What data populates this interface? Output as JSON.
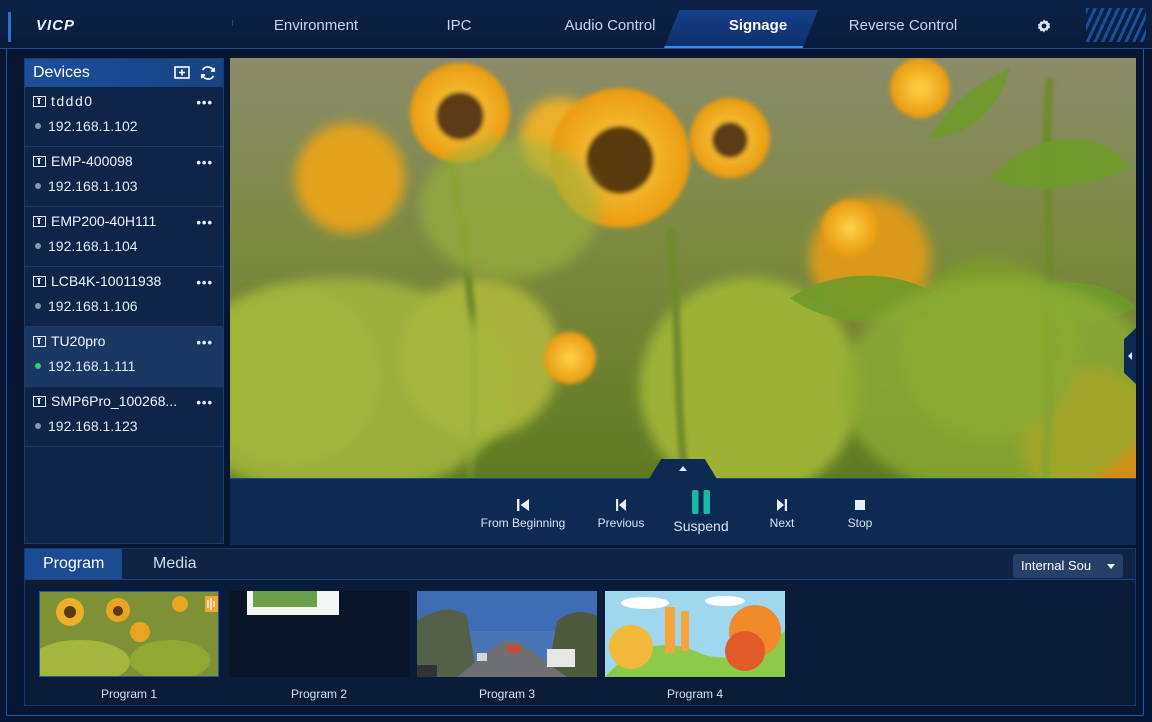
{
  "app": {
    "logo": "VICP"
  },
  "nav": {
    "items": [
      {
        "label": "Environment"
      },
      {
        "label": "IPC"
      },
      {
        "label": "Audio Control"
      },
      {
        "label": "Signage"
      },
      {
        "label": "Reverse Control"
      }
    ],
    "active": "Signage",
    "settings_icon": "gear-icon"
  },
  "devices": {
    "title": "Devices",
    "icons": [
      "add-screen-icon",
      "refresh-icon"
    ],
    "items": [
      {
        "name": "tddd0",
        "ip": "192.168.1.102",
        "online": false
      },
      {
        "name": "EMP-400098",
        "ip": "192.168.1.103",
        "online": false
      },
      {
        "name": "EMP200-40H111",
        "ip": "192.168.1.104",
        "online": false
      },
      {
        "name": "LCB4K-10011938",
        "ip": "192.168.1.106",
        "online": false
      },
      {
        "name": "TU20pro",
        "ip": "192.168.1.111",
        "online": true
      },
      {
        "name": "SMP6Pro_100268...",
        "ip": "192.168.1.123",
        "online": false
      }
    ],
    "more_label": "•••"
  },
  "playback": {
    "from_beginning": "From Beginning",
    "previous": "Previous",
    "suspend": "Suspend",
    "next": "Next",
    "stop": "Stop"
  },
  "program_panel": {
    "tabs": [
      {
        "label": "Program"
      },
      {
        "label": "Media"
      }
    ],
    "active_tab": "Program",
    "source_select": "Internal Sou",
    "programs": [
      {
        "label": "Program 1"
      },
      {
        "label": "Program 2"
      },
      {
        "label": "Program 3"
      },
      {
        "label": "Program 4"
      }
    ]
  },
  "colors": {
    "background": "#061633",
    "accent": "#1b4b93",
    "online": "#24d36a",
    "suspend_icon": "#19b8a8"
  }
}
